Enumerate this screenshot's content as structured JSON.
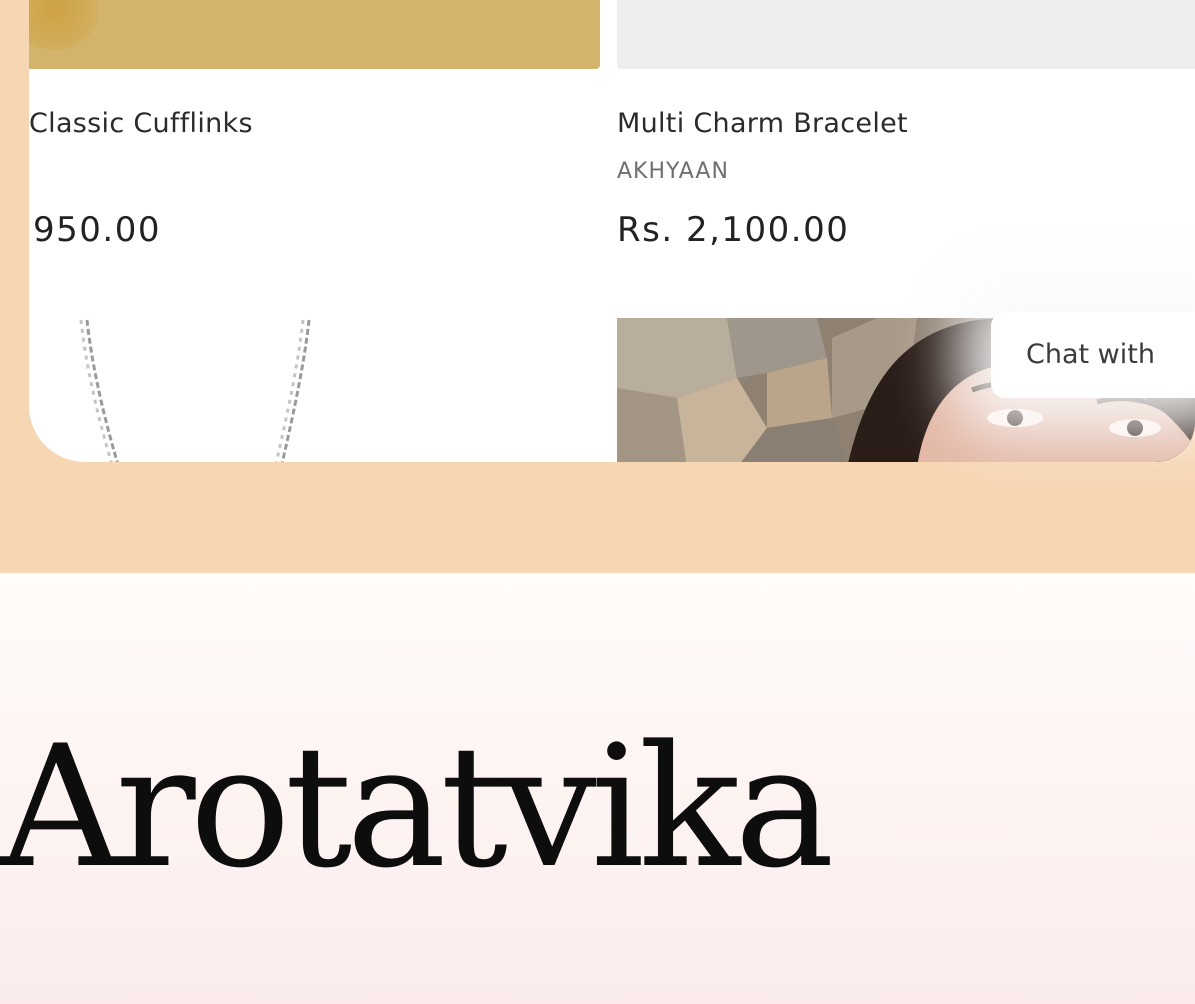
{
  "products": [
    {
      "title": "Classic Cufflinks",
      "vendor": "",
      "price": "950.00"
    },
    {
      "title": "Multi Charm Bracelet",
      "vendor": "AKHYAAN",
      "price": "Rs. 2,100.00"
    }
  ],
  "chat": {
    "label": "Chat with"
  },
  "brand": {
    "name": "Arotatvika"
  },
  "colors": {
    "band": "#f7d6b3",
    "gold_image": "#d4b46b",
    "hero_top": "#fffcfa",
    "hero_bottom": "#fbeceb"
  }
}
